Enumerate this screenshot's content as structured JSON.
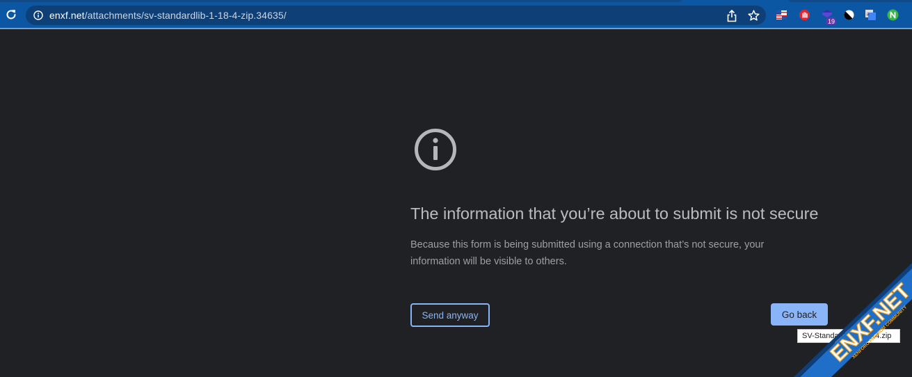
{
  "browser": {
    "url_host": "enxf.net",
    "url_path": "/attachments/sv-standardlib-1-18-4-zip.34635/",
    "extension_badge": "19"
  },
  "interstitial": {
    "heading": "The information that you’re about to submit is not secure",
    "body": "Because this form is being submitted using a connection that’s not secure, your information will be visible to others.",
    "send_anyway_label": "Send anyway",
    "go_back_label": "Go back"
  },
  "tooltip": {
    "text": "SV-StandardLib-1.18.4.zip"
  },
  "watermark": {
    "brand": "ENXF.NET",
    "tagline": "XENFORO PREMIUM COMMUNITY"
  },
  "colors": {
    "page_background": "#202124",
    "toolbar": "#0b57a4",
    "accent": "#8ab4f8",
    "ribbon_blue": "#1f6fc9",
    "ribbon_orange": "#f5a623"
  }
}
